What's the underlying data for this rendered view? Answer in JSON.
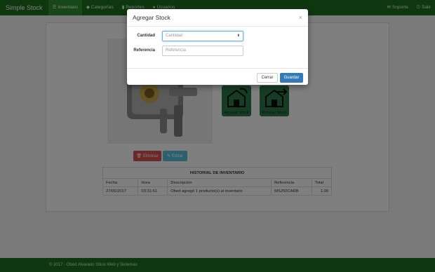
{
  "navbar": {
    "brand": "Simple Stock",
    "items": [
      {
        "label": "Inventario",
        "icon": "list-icon",
        "active": true
      },
      {
        "label": "Categorías",
        "icon": "tags-icon",
        "active": false
      },
      {
        "label": "Reportes",
        "icon": "bar-chart-icon",
        "active": false
      },
      {
        "label": "Usuarios",
        "icon": "user-icon",
        "active": false
      }
    ],
    "right_items": [
      {
        "label": "Soporte",
        "icon": "envelope-icon"
      },
      {
        "label": "Salir",
        "icon": "power-icon"
      }
    ]
  },
  "product": {
    "add_stock_label": "Agregar Stock",
    "remove_stock_label": "Eliminar Stock",
    "delete_label": "Eliminar",
    "edit_label": "Editar"
  },
  "history": {
    "title": "HISTORIAL DE INVENTARIO",
    "columns": [
      "Fecha",
      "Hora",
      "Descripción",
      "Referencia",
      "Total"
    ],
    "rows": [
      {
        "fecha": "27/06/2017",
        "hora": "03:31:51",
        "descripcion": "Obed agregó 1 producto(s) al inventario",
        "referencia": "MS250CARB",
        "total": "1.00"
      }
    ]
  },
  "footer": {
    "text": "© 2017 - Obed Alvarado Sitios Web y Sistemas"
  },
  "modal": {
    "title": "Agregar Stock",
    "close": "×",
    "fields": {
      "cantidad": {
        "label": "Cantidad",
        "placeholder": "Cantidad",
        "value": ""
      },
      "referencia": {
        "label": "Referencia",
        "placeholder": "Referencia",
        "value": ""
      }
    },
    "cancel_label": "Cerrar",
    "save_label": "Guardar"
  },
  "colors": {
    "brand_green": "#1e6f1e",
    "active_green": "#2f8f2f",
    "danger": "#d9534f",
    "info": "#5bc0de",
    "primary": "#337ab7",
    "stock_button": "#2d7a48"
  }
}
